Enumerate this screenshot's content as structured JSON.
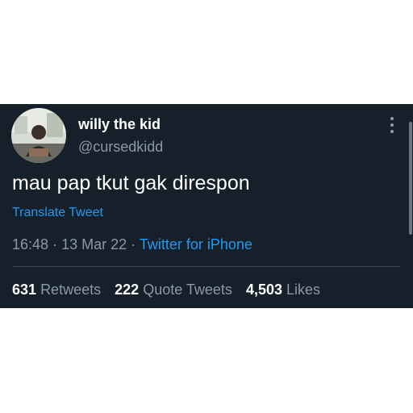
{
  "tweet": {
    "display_name": "willy the kid",
    "handle": "@cursedkidd",
    "text": "mau pap tkut gak direspon",
    "translate_label": "Translate Tweet",
    "time": "16:48",
    "date": "13 Mar 22",
    "separator": "·",
    "source": "Twitter for iPhone"
  },
  "stats": [
    {
      "count": "631",
      "label": "Retweets"
    },
    {
      "count": "222",
      "label": "Quote Tweets"
    },
    {
      "count": "4,503",
      "label": "Likes"
    }
  ],
  "icons": {
    "more": "more-vertical-icon"
  },
  "colors": {
    "background": "#15202b",
    "text_primary": "#ffffff",
    "text_secondary": "#8b98a5",
    "link": "#1d9bf0",
    "divider": "#38444d"
  }
}
